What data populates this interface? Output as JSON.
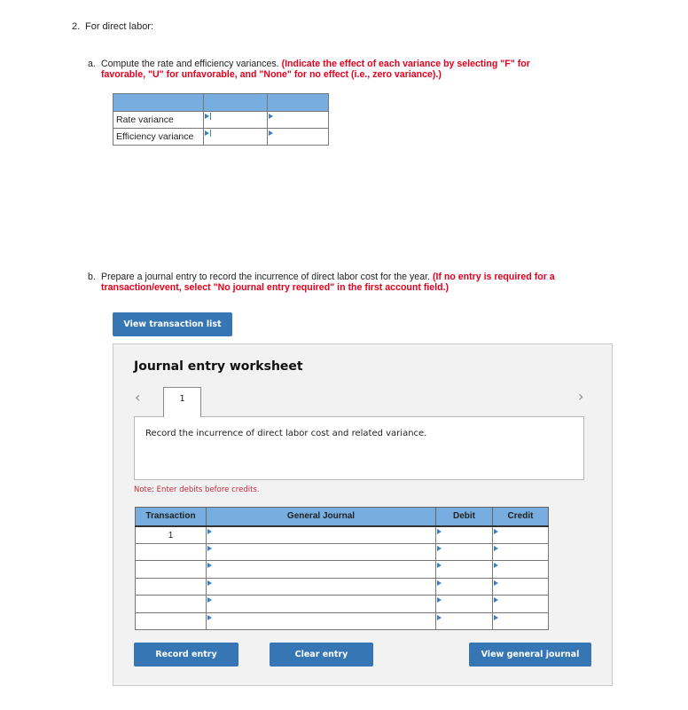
{
  "question": {
    "number": "2.",
    "title": "For direct labor:"
  },
  "part_a": {
    "letter": "a.",
    "instruction": "Compute the rate and efficiency variances.",
    "note": "(Indicate the effect of each variance by selecting \"F\" for favorable, \"U\" for unfavorable, and \"None\" for no effect (i.e., zero variance).)",
    "table": {
      "header": [
        "",
        "",
        ""
      ],
      "rows": [
        {
          "label": "Rate variance",
          "amount": "",
          "effect": ""
        },
        {
          "label": "Efficiency variance",
          "amount": "",
          "effect": ""
        }
      ]
    }
  },
  "part_b": {
    "letter": "b.",
    "instruction": "Prepare a journal entry to record the incurrence of direct labor cost for the year.",
    "note": "(If no entry is required for a transaction/event, select \"No journal entry required\" in the first account field.)"
  },
  "buttons": {
    "view_transaction_list": "View transaction list",
    "record_entry": "Record entry",
    "clear_entry": "Clear entry",
    "view_general_journal": "View general journal"
  },
  "worksheet": {
    "title": "Journal entry worksheet",
    "prev_icon": "‹",
    "next_icon": "›",
    "tabs": [
      "1"
    ],
    "description": "Record the incurrence of direct labor cost and related variance.",
    "note": "Note: Enter debits before credits.",
    "columns": [
      "Transaction",
      "General Journal",
      "Debit",
      "Credit"
    ],
    "rows": [
      {
        "transaction": "1",
        "account": "",
        "debit": "",
        "credit": ""
      },
      {
        "transaction": "",
        "account": "",
        "debit": "",
        "credit": ""
      },
      {
        "transaction": "",
        "account": "",
        "debit": "",
        "credit": ""
      },
      {
        "transaction": "",
        "account": "",
        "debit": "",
        "credit": ""
      },
      {
        "transaction": "",
        "account": "",
        "debit": "",
        "credit": ""
      },
      {
        "transaction": "",
        "account": "",
        "debit": "",
        "credit": ""
      }
    ]
  },
  "colors": {
    "accent": "#3676b5",
    "table_header": "#77aedf",
    "instruction_red": "#e5001e",
    "note_red": "#c8293d",
    "panel_bg": "#f2f2f2"
  }
}
